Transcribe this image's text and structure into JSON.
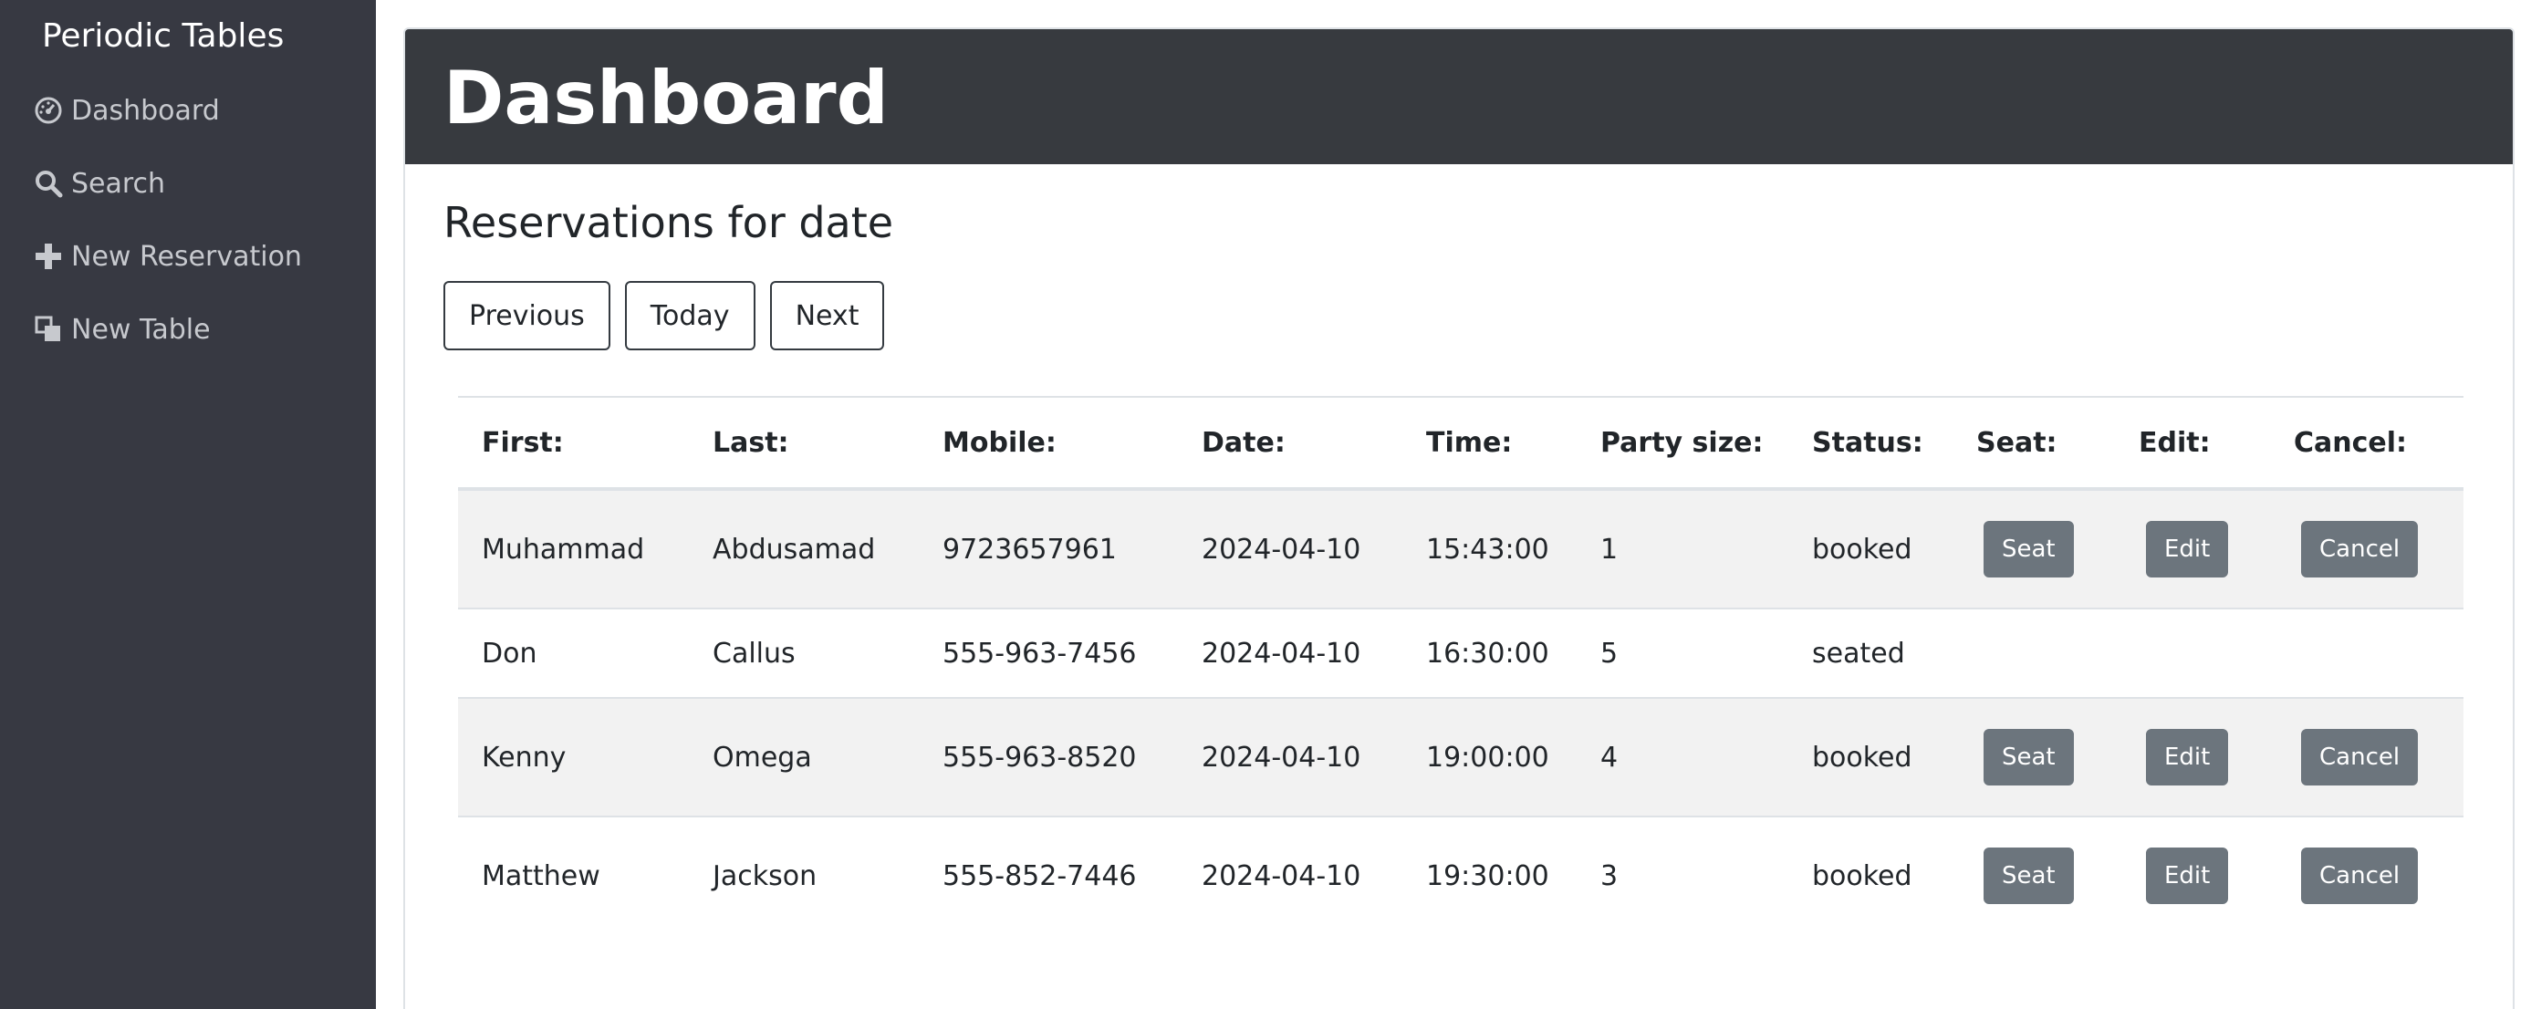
{
  "sidebar": {
    "brand": "Periodic Tables",
    "items": [
      {
        "label": "Dashboard",
        "icon": "dashboard-icon"
      },
      {
        "label": "Search",
        "icon": "search-icon"
      },
      {
        "label": "New Reservation",
        "icon": "plus-icon"
      },
      {
        "label": "New Table",
        "icon": "table-icon"
      }
    ]
  },
  "header": {
    "title": "Dashboard"
  },
  "main": {
    "subtitle": "Reservations for date",
    "date_nav": {
      "previous": "Previous",
      "today": "Today",
      "next": "Next"
    },
    "table": {
      "columns": [
        "First:",
        "Last:",
        "Mobile:",
        "Date:",
        "Time:",
        "Party size:",
        "Status:",
        "Seat:",
        "Edit:",
        "Cancel:"
      ],
      "rows": [
        {
          "first": "Muhammad",
          "last": "Abdusamad",
          "mobile": "9723657961",
          "date": "2024-04-10",
          "time": "15:43:00",
          "party": "1",
          "status": "booked",
          "seat": "Seat",
          "edit": "Edit",
          "cancel": "Cancel"
        },
        {
          "first": "Don",
          "last": "Callus",
          "mobile": "555-963-7456",
          "date": "2024-04-10",
          "time": "16:30:00",
          "party": "5",
          "status": "seated"
        },
        {
          "first": "Kenny",
          "last": "Omega",
          "mobile": "555-963-8520",
          "date": "2024-04-10",
          "time": "19:00:00",
          "party": "4",
          "status": "booked",
          "seat": "Seat",
          "edit": "Edit",
          "cancel": "Cancel"
        },
        {
          "first": "Matthew",
          "last": "Jackson",
          "mobile": "555-852-7446",
          "date": "2024-04-10",
          "time": "19:30:00",
          "party": "3",
          "status": "booked",
          "seat": "Seat",
          "edit": "Edit",
          "cancel": "Cancel"
        }
      ]
    }
  },
  "colors": {
    "sidebar_bg": "#373942",
    "header_bg": "#373a3f",
    "nav_text": "#c7c9ce",
    "button_secondary": "#6c757d",
    "row_stripe": "#f2f2f2"
  }
}
